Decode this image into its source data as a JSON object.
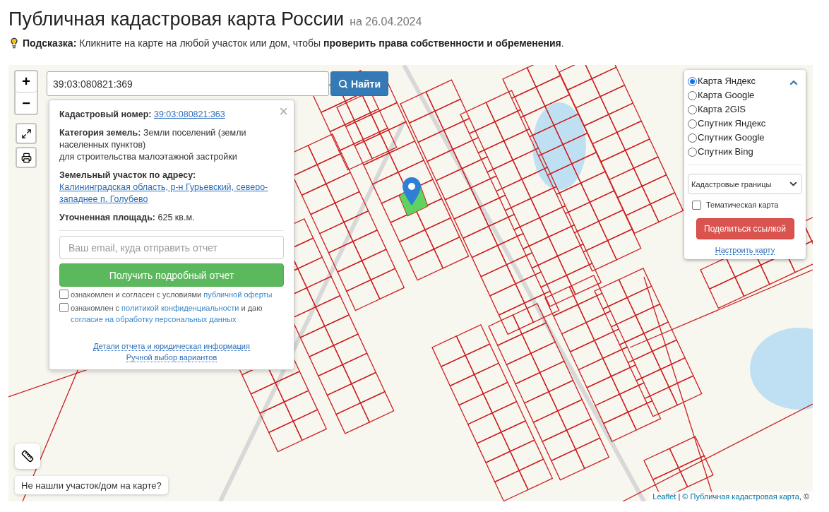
{
  "header": {
    "title": "Публичная кадастровая карта России",
    "date": "на 26.04.2024"
  },
  "hint": {
    "text": "**Подсказка:** Кликните на карте на любой участок или дом, чтобы **проверить права собственности и обременения**."
  },
  "zoom_controls": [
    "+",
    "−"
  ],
  "search": {
    "value": "39:03:080821:369",
    "button": "Найти"
  },
  "popup": {
    "close": "×",
    "fields": [
      {
        "label": "Кадастровый номер:",
        "value": "39:03:080821:363",
        "kind": "link"
      },
      {
        "label": "Категория земель:",
        "value": "Земли поселений (земли населенных пунктов)",
        "extra": "для строительства малоэтажной застройки",
        "kind": "text"
      },
      {
        "label": "Земельный участок по адресу:",
        "value": "Калининградская область, р-н Гурьевский, северо-западнее п. Голубево",
        "kind": "link"
      },
      {
        "label": "Уточненная площадь:",
        "value": "625 кв.м.",
        "kind": "text"
      }
    ],
    "email_placeholder": "Ваш email, куда отправить отчет",
    "submit": "Получить подробный отчет",
    "consents": [
      {
        "checked": false,
        "parts": [
          {
            "text": "ознакомлен и согласен с условиями ",
            "link": false
          },
          {
            "text": "публичной оферты",
            "link": true
          }
        ]
      },
      {
        "checked": false,
        "parts": [
          {
            "text": "ознакомлен с ",
            "link": false
          },
          {
            "text": "политикой конфиденциальности",
            "link": true
          },
          {
            "text": " и даю ",
            "link": false
          },
          {
            "text": "согласие на обработку персональных данных",
            "link": true
          }
        ]
      }
    ],
    "links": [
      "Детали отчета и юридическая информация",
      "Ручной выбор вариантов"
    ]
  },
  "layers": {
    "options": [
      {
        "label": "Карта Яндекс",
        "selected": true
      },
      {
        "label": "Карта Google",
        "selected": false
      },
      {
        "label": "Карта 2GIS",
        "selected": false
      },
      {
        "label": "Спутник Яндекс",
        "selected": false
      },
      {
        "label": "Спутник Google",
        "selected": false
      },
      {
        "label": "Спутник Bing",
        "selected": false
      }
    ],
    "overlay_select": "Кадастровые границы",
    "thematic": {
      "label": "Тематическая карта",
      "checked": false
    },
    "share_button": "Поделиться ссылкой",
    "settings_link": "Настроить карту"
  },
  "not_found_button": "Не нашли участок/дом на карте?",
  "attribution": [
    {
      "text": "Leaflet",
      "link": true
    },
    {
      "text": " | ",
      "link": false
    },
    {
      "text": "© Публичная кадастровая карта",
      "link": true
    },
    {
      "text": ", ©",
      "link": false
    }
  ]
}
